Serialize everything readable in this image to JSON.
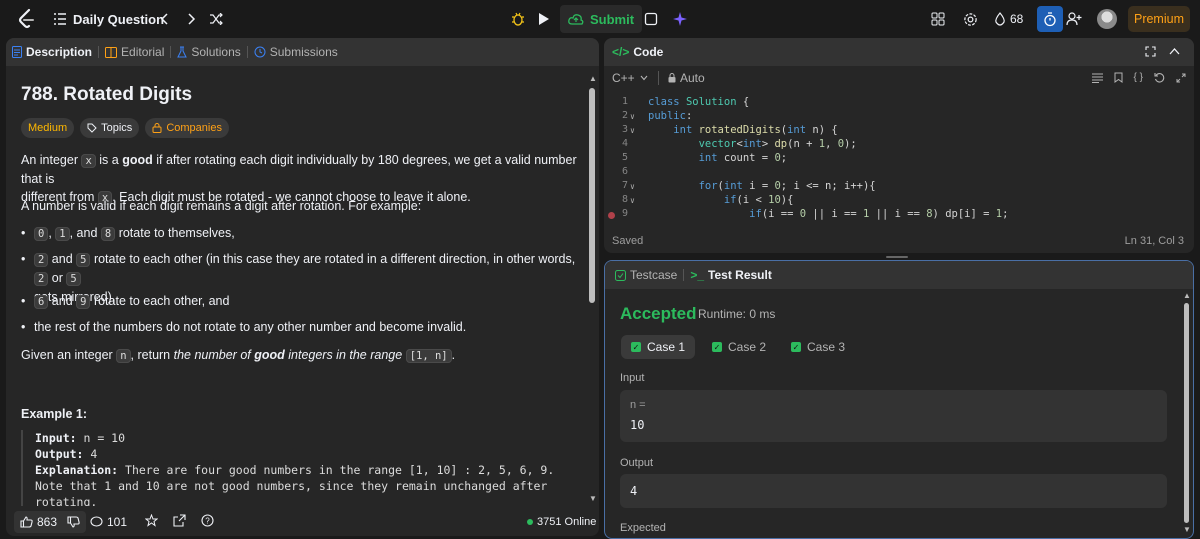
{
  "topbar": {
    "title": "Daily Question",
    "submit_label": "Submit",
    "streak_count": "68",
    "premium_label": "Premium"
  },
  "left_tabs": [
    {
      "label": "Description"
    },
    {
      "label": "Editorial"
    },
    {
      "label": "Solutions"
    },
    {
      "label": "Submissions"
    }
  ],
  "problem": {
    "title": "788. Rotated Digits",
    "difficulty": "Medium",
    "topics_label": "Topics",
    "companies_label": "Companies",
    "p1_a": "An integer ",
    "p1_code": "x",
    "p1_b": " is a ",
    "p1_bold": "good",
    "p1_c": " if after rotating each digit individually by 180 degrees, we get a valid number that is",
    "p1_d": "different from ",
    "p1_code2": "x",
    "p1_e": ". Each digit must be rotated - we cannot choose to leave it alone.",
    "p2": "A number is valid if each digit remains a digit after rotation. For example:",
    "b1_c1": "0",
    "b1_sep": ", ",
    "b1_c2": "1",
    "b1_and": ", and ",
    "b1_c3": "8",
    "b1_rest": " rotate to themselves,",
    "b2_c1": "2",
    "b2_and": " and ",
    "b2_c2": "5",
    "b2_rest": " rotate to each other (in this case they are rotated in a different direction, in other words, ",
    "b2_c3": "2",
    "b2_or": " or ",
    "b2_c4": "5",
    "b2_line2": "gets mirrored),",
    "b3_c1": "6",
    "b3_and": " and ",
    "b3_c2": "9",
    "b3_rest": " rotate to each other, and",
    "b4": "the rest of the numbers do not rotate to any other number and become invalid.",
    "p3_a": "Given an integer ",
    "p3_code": "n",
    "p3_b": ", return ",
    "p3_it1": "the number of ",
    "p3_bold": "good",
    "p3_it2": " integers in the range ",
    "p3_code2": "[1, n]",
    "p3_c": ".",
    "example_title": "Example 1:",
    "ex_input_label": "Input:",
    "ex_input_val": " n = 10",
    "ex_output_label": "Output:",
    "ex_output_val": " 4",
    "ex_expl_label": "Explanation:",
    "ex_expl_1": " There are four good numbers in the range [1, 10] : 2, 5, 6, 9.",
    "ex_expl_2": "Note that 1 and 10 are not good numbers, since they remain unchanged after",
    "ex_expl_3": "rotating."
  },
  "left_footer": {
    "likes": "863",
    "comments": "101",
    "online": "3751 Online"
  },
  "code_panel": {
    "tab_label": "Code",
    "language": "C++",
    "auto_label": "Auto",
    "saved_label": "Saved",
    "cursor_pos": "Ln 31, Col 3",
    "lines": [
      {
        "n": "1",
        "text": "class Solution {"
      },
      {
        "n": "2",
        "text": "public:"
      },
      {
        "n": "3",
        "text": "    int rotatedDigits(int n) {"
      },
      {
        "n": "4",
        "text": "        vector<int> dp(n + 1, 0);"
      },
      {
        "n": "5",
        "text": "        int count = 0;"
      },
      {
        "n": "6",
        "text": ""
      },
      {
        "n": "7",
        "text": "        for(int i = 0; i <= n; i++){"
      },
      {
        "n": "8",
        "text": "            if(i < 10){"
      },
      {
        "n": "9",
        "text": "                if(i == 0 || i == 1 || i == 8) dp[i] = 1;"
      }
    ]
  },
  "result_panel": {
    "testcase_label": "Testcase",
    "result_label": "Test Result",
    "status": "Accepted",
    "runtime": "Runtime: 0 ms",
    "cases": [
      "Case 1",
      "Case 2",
      "Case 3"
    ],
    "input_label": "Input",
    "input_var": "n =",
    "input_value": "10",
    "output_label": "Output",
    "output_value": "4",
    "expected_label": "Expected"
  },
  "colors": {
    "accent_green": "#2cbb5d",
    "medium": "#ffb800",
    "premium": "#ffa116"
  }
}
